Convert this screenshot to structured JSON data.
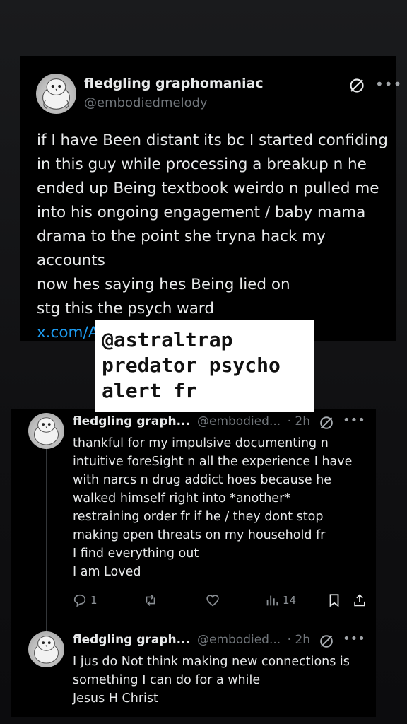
{
  "top_tweet": {
    "display_name": "fledgling graphomaniac",
    "handle": "@embodiedmelody",
    "lines": [
      "if I have Been distant its bc I started confiding",
      "in this guy while processing a breakup n he",
      "ended up Being textbook weirdo n pulled me",
      "into his ongoing engagement / baby mama",
      "drama to the point she tryna hack my",
      "accounts",
      "now hes saying hes Being lied on",
      "stg this the psych ward"
    ],
    "link": "x.com/A"
  },
  "sticker": {
    "lines": [
      "@astraltrap",
      "predator psycho",
      "alert fr"
    ]
  },
  "replies": [
    {
      "display_name": "fledgling graph...",
      "handle": "@embodied...",
      "time": "· 2h",
      "lines": [
        "thankful for my impulsive documenting n",
        "intuitive foreSight n all the experience I have",
        "with narcs n drug addict hoes because he",
        "walked himself right into *another*",
        "restraining order fr if he / they dont stop",
        "making open threats on my household fr",
        "I find everything out",
        "I am Loved"
      ],
      "actions": {
        "reply_count": "1",
        "repost_count": "",
        "like_count": "",
        "views_count": "14"
      }
    },
    {
      "display_name": "fledgling graph...",
      "handle": "@embodied...",
      "time": "· 2h",
      "lines": [
        "I jus do Not think making new connections is",
        "something I can do for a while",
        "Jesus H Christ"
      ]
    }
  ],
  "icons": {
    "no_entry": "no-entry-icon",
    "more": "more-icon",
    "reply": "reply-icon",
    "repost": "repost-icon",
    "like": "heart-icon",
    "views": "views-icon",
    "bookmark": "bookmark-icon",
    "share": "share-icon"
  },
  "colors": {
    "link": "#1d9bf0",
    "muted": "#71767b",
    "text": "#e7e9ea"
  }
}
